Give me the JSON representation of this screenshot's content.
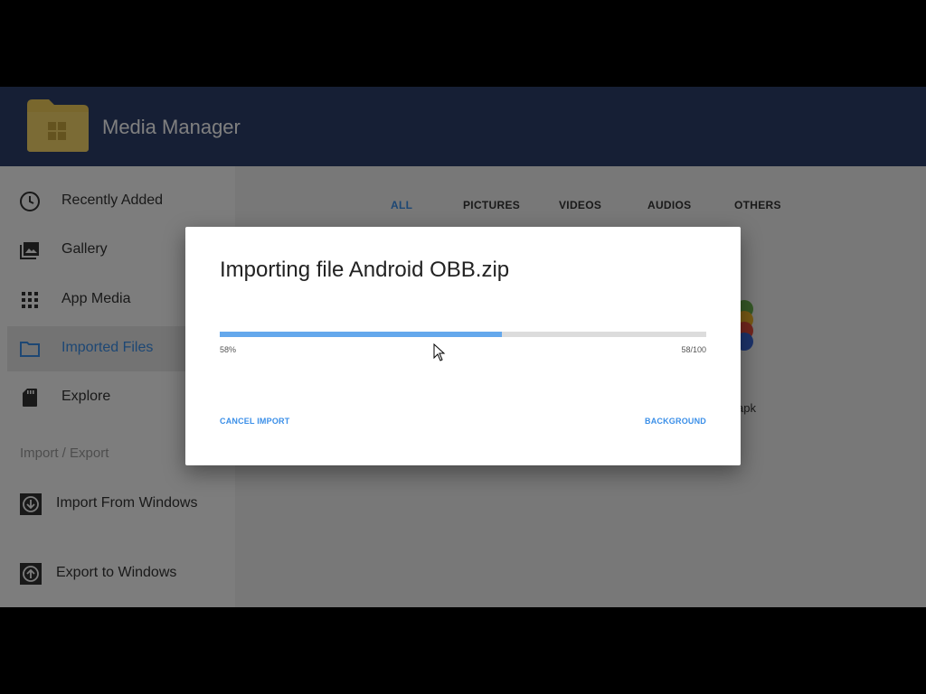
{
  "header": {
    "title": "Media Manager",
    "logo_icon": "folder-windows-icon"
  },
  "sidebar": {
    "items": [
      {
        "label": "Recently Added",
        "icon": "clock-icon",
        "active": false
      },
      {
        "label": "Gallery",
        "icon": "gallery-icon",
        "active": false
      },
      {
        "label": "App Media",
        "icon": "grid-icon",
        "active": false
      },
      {
        "label": "Imported Files",
        "icon": "folder-icon",
        "active": true
      },
      {
        "label": "Explore",
        "icon": "sd-card-icon",
        "active": false
      }
    ],
    "section_title": "Import / Export",
    "io_items": [
      {
        "label": "Import From Windows",
        "icon": "import-icon"
      },
      {
        "label": "Export to Windows",
        "icon": "export-icon"
      }
    ]
  },
  "tabs": [
    {
      "label": "ALL",
      "active": true
    },
    {
      "label": "PICTURES",
      "active": false
    },
    {
      "label": "VIDEOS",
      "active": false
    },
    {
      "label": "AUDIOS",
      "active": false
    },
    {
      "label": "OTHERS",
      "active": false
    }
  ],
  "file": {
    "name_fragment": "apk"
  },
  "dialog": {
    "title": "Importing file Android OBB.zip",
    "progress": 0.58,
    "percent_label": "58%",
    "count_label": "58/100",
    "cancel_label": "CANCEL IMPORT",
    "background_label": "BACKGROUND"
  },
  "colors": {
    "header_bg": "#2c3e6b",
    "accent": "#3b8fe8",
    "progress_fill": "#64a8ec",
    "folder_yellow": "#f3cf5a"
  }
}
